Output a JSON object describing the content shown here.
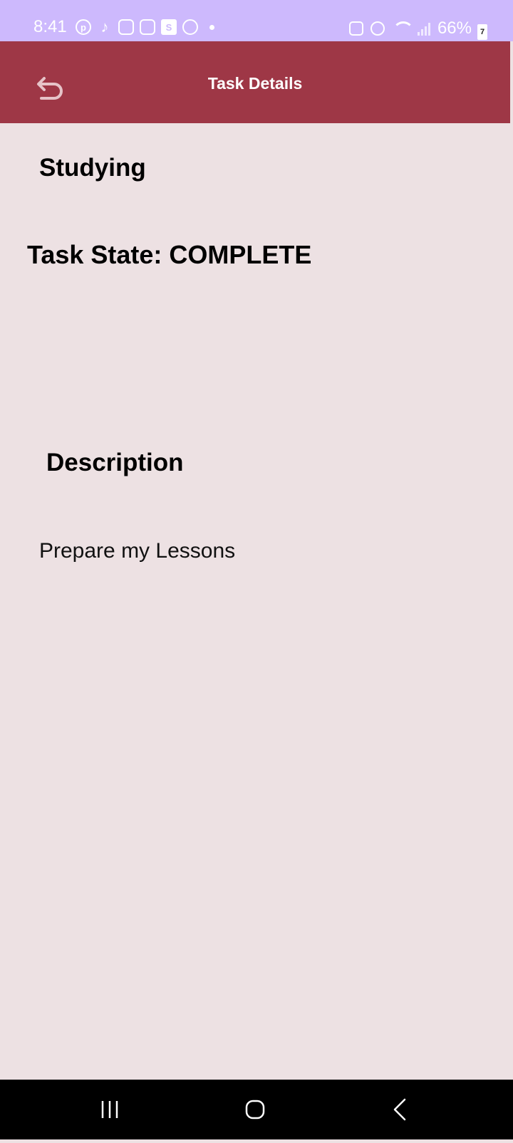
{
  "status_bar": {
    "time": "8:41",
    "notification_icons": [
      "pinterest-icon",
      "tiktok-icon",
      "instagram-icon",
      "instagram-icon",
      "s-app-icon",
      "browser-icon"
    ],
    "battery": "66%",
    "battery_badge": "7"
  },
  "app_bar": {
    "title": "Task Details",
    "back_icon": "undo-arrow-icon"
  },
  "task": {
    "title": "Studying",
    "state_label": "Task State: COMPLETE",
    "description_heading": "Description",
    "description": "Prepare my Lessons"
  },
  "nav_bar": {
    "buttons": [
      "recents-icon",
      "home-icon",
      "back-icon"
    ]
  },
  "colors": {
    "status_bar": "#cdb9fd",
    "app_bar": "#9e3746",
    "background": "#ede1e3",
    "nav_bar": "#000000"
  }
}
